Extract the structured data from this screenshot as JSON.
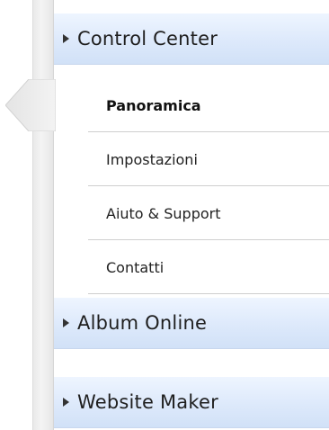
{
  "sidebar": {
    "sections": [
      {
        "label": "Control Center",
        "expanded": true
      },
      {
        "label": "Album Online",
        "expanded": false
      },
      {
        "label": "Website Maker",
        "expanded": false
      }
    ],
    "control_center_items": [
      {
        "label": "Panoramica",
        "active": true
      },
      {
        "label": "Impostazioni",
        "active": false
      },
      {
        "label": "Aiuto & Support",
        "active": false
      },
      {
        "label": "Contatti",
        "active": false
      }
    ],
    "icons": {
      "section_arrow": "triangle-right-icon",
      "active_indicator": "selection-pointer-icon"
    },
    "colors": {
      "header_gradient_top": "#eef5ff",
      "header_gradient_bottom": "#d1e1f7",
      "divider": "#cfcfcf",
      "text": "#1f1f1f"
    }
  }
}
